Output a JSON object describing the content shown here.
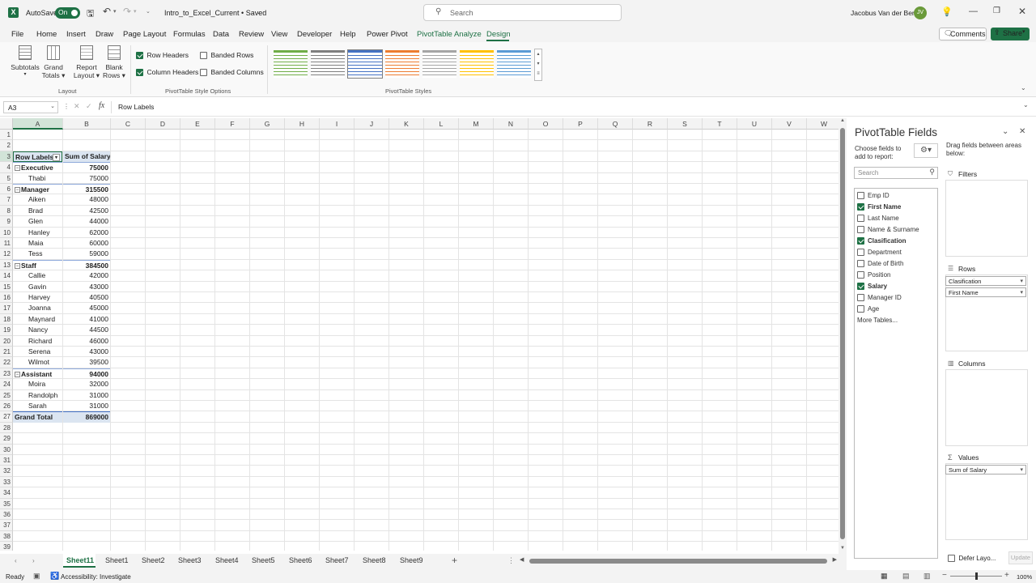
{
  "titlebar": {
    "autosave_label": "AutoSave",
    "autosave_state": "On",
    "filename": "Intro_to_Excel_Current • Saved",
    "search_placeholder": "Search",
    "user_name": "Jacobus Van der Berg",
    "user_initials": "JV"
  },
  "menu": {
    "items": [
      "File",
      "Home",
      "Insert",
      "Draw",
      "Page Layout",
      "Formulas",
      "Data",
      "Review",
      "View",
      "Developer",
      "Help",
      "Power Pivot",
      "PivotTable Analyze",
      "Design"
    ],
    "comments_label": "Comments",
    "share_label": "Share"
  },
  "ribbon": {
    "layout_buttons": [
      {
        "label1": "Subtotals",
        "label2": ""
      },
      {
        "label1": "Grand",
        "label2": "Totals"
      },
      {
        "label1": "Report",
        "label2": "Layout"
      },
      {
        "label1": "Blank",
        "label2": "Rows"
      }
    ],
    "layout_group": "Layout",
    "style_options": {
      "row_headers": "Row Headers",
      "banded_rows": "Banded Rows",
      "column_headers": "Column Headers",
      "banded_columns": "Banded Columns",
      "row_headers_checked": true,
      "column_headers_checked": true,
      "banded_rows_checked": false,
      "banded_columns_checked": false,
      "group": "PivotTable Style Options"
    },
    "styles_group": "PivotTable Styles",
    "style_colors": [
      "#70ad47",
      "#7f7f7f",
      "#4472c4",
      "#ed7d31",
      "#a5a5a5",
      "#ffc000",
      "#5b9bd5"
    ]
  },
  "formula": {
    "name_box": "A3",
    "fx": "fx",
    "content": "Row Labels"
  },
  "columns": [
    "A",
    "B",
    "C",
    "D",
    "E",
    "F",
    "G",
    "H",
    "I",
    "J",
    "K",
    "L",
    "M",
    "N",
    "O",
    "P",
    "Q",
    "R",
    "S",
    "T",
    "U",
    "V",
    "W"
  ],
  "rows": [
    "1",
    "2",
    "3",
    "4",
    "5",
    "6",
    "7",
    "8",
    "9",
    "10",
    "11",
    "12",
    "13",
    "14",
    "15",
    "16",
    "17",
    "18",
    "19",
    "20",
    "21",
    "22",
    "23",
    "24",
    "25",
    "26",
    "27",
    "28",
    "29",
    "30",
    "31",
    "32",
    "33",
    "34",
    "35",
    "36",
    "37",
    "38",
    "39"
  ],
  "pivot": {
    "header_a": "Row Labels",
    "header_b": "Sum of Salary",
    "rows": [
      {
        "label": "Executive",
        "value": "75000",
        "level": 0
      },
      {
        "label": "Thabi",
        "value": "75000",
        "level": 1
      },
      {
        "label": "Manager",
        "value": "315500",
        "level": 0
      },
      {
        "label": "Aiken",
        "value": "48000",
        "level": 1
      },
      {
        "label": "Brad",
        "value": "42500",
        "level": 1
      },
      {
        "label": "Glen",
        "value": "44000",
        "level": 1
      },
      {
        "label": "Hanley",
        "value": "62000",
        "level": 1
      },
      {
        "label": "Maia",
        "value": "60000",
        "level": 1
      },
      {
        "label": "Tess",
        "value": "59000",
        "level": 1
      },
      {
        "label": "Staff",
        "value": "384500",
        "level": 0
      },
      {
        "label": "Callie",
        "value": "42000",
        "level": 1
      },
      {
        "label": "Gavin",
        "value": "43000",
        "level": 1
      },
      {
        "label": "Harvey",
        "value": "40500",
        "level": 1
      },
      {
        "label": "Joanna",
        "value": "45000",
        "level": 1
      },
      {
        "label": "Maynard",
        "value": "41000",
        "level": 1
      },
      {
        "label": "Nancy",
        "value": "44500",
        "level": 1
      },
      {
        "label": "Richard",
        "value": "46000",
        "level": 1
      },
      {
        "label": "Serena",
        "value": "43000",
        "level": 1
      },
      {
        "label": "Wilmot",
        "value": "39500",
        "level": 1
      },
      {
        "label": "Assistant",
        "value": "94000",
        "level": 0
      },
      {
        "label": "Moira",
        "value": "32000",
        "level": 1
      },
      {
        "label": "Randolph",
        "value": "31000",
        "level": 1
      },
      {
        "label": "Sarah",
        "value": "31000",
        "level": 1
      }
    ],
    "grand_total_label": "Grand Total",
    "grand_total_value": "869000"
  },
  "pane": {
    "title": "PivotTable Fields",
    "choose_label": "Choose fields to add to report:",
    "drag_label": "Drag fields between areas below:",
    "search_placeholder": "Search",
    "fields": [
      {
        "name": "Emp ID",
        "checked": false
      },
      {
        "name": "First Name",
        "checked": true
      },
      {
        "name": "Last Name",
        "checked": false
      },
      {
        "name": "Name & Surname",
        "checked": false
      },
      {
        "name": "Clasification",
        "checked": true
      },
      {
        "name": "Department",
        "checked": false
      },
      {
        "name": "Date of Birth",
        "checked": false
      },
      {
        "name": "Position",
        "checked": false
      },
      {
        "name": "Salary",
        "checked": true
      },
      {
        "name": "Manager ID",
        "checked": false
      },
      {
        "name": "Age",
        "checked": false
      }
    ],
    "more_tables": "More Tables...",
    "filters_label": "Filters",
    "rows_label": "Rows",
    "rows_items": [
      "Clasification",
      "First Name"
    ],
    "columns_label": "Columns",
    "values_label": "Values",
    "values_items": [
      "Sum of Salary"
    ],
    "defer_label": "Defer Layo...",
    "update_label": "Update"
  },
  "sheets": [
    "Sheet11",
    "Sheet1",
    "Sheet2",
    "Sheet3",
    "Sheet4",
    "Sheet5",
    "Sheet6",
    "Sheet7",
    "Sheet8",
    "Sheet9"
  ],
  "status": {
    "ready": "Ready",
    "accessibility": "Accessibility: Investigate",
    "zoom": "100%"
  }
}
